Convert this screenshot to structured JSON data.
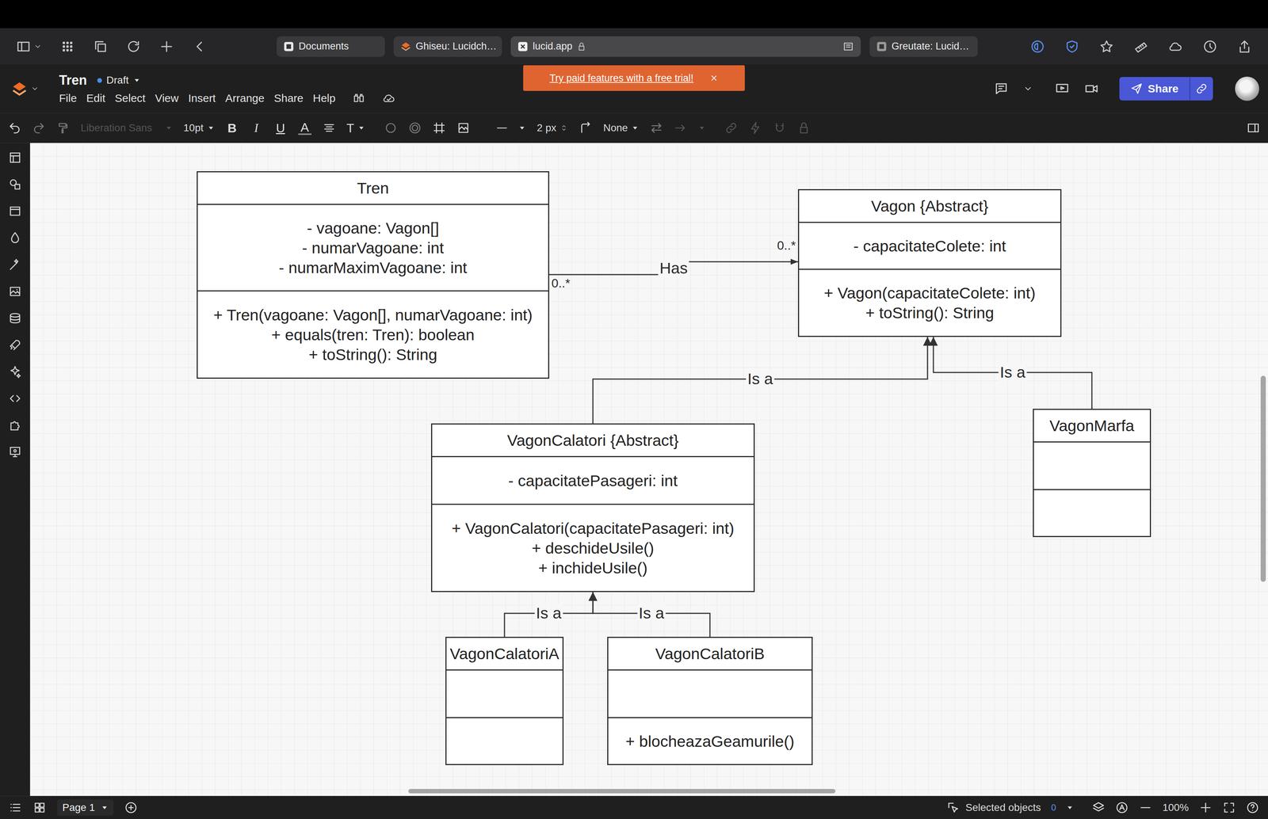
{
  "browser": {
    "tabs": [
      {
        "label": "Documents",
        "selected": false
      },
      {
        "label": "Ghiseu: Lucidch…",
        "selected": false
      },
      {
        "label": "lucid.app",
        "selected": true
      },
      {
        "label": "Greutate: Lucid…",
        "selected": false
      }
    ]
  },
  "document": {
    "title": "Tren",
    "status": "Draft"
  },
  "menu": [
    "File",
    "Edit",
    "Select",
    "View",
    "Insert",
    "Arrange",
    "Share",
    "Help"
  ],
  "banner": {
    "text": "Try paid features with a free trial!"
  },
  "share_button": "Share",
  "toolbar": {
    "font": {
      "value": "Liberation Sans",
      "disabled": true
    },
    "size": "10pt",
    "format": [
      {
        "label": "B",
        "kind": "bold"
      },
      {
        "label": "I",
        "kind": "italic"
      },
      {
        "label": "U",
        "kind": "underline"
      },
      {
        "label": "A",
        "kind": "color"
      }
    ],
    "text_tool": "T",
    "line_width": "2 px",
    "end_style": "None"
  },
  "diagram": {
    "classes": [
      {
        "name": "Tren",
        "attributes": [
          "- vagoane: Vagon[]",
          "- numarVagoane: int",
          "- numarMaximVagoane: int"
        ],
        "methods": [
          "+ Tren(vagoane: Vagon[], numarVagoane: int)",
          "+ equals(tren: Tren): boolean",
          "+ toString(): String"
        ]
      },
      {
        "name": "Vagon {Abstract}",
        "attributes": [
          "- capacitateColete: int"
        ],
        "methods": [
          "+ Vagon(capacitateColete: int)",
          "+ toString(): String"
        ]
      },
      {
        "name": "VagonCalatori {Abstract}",
        "attributes": [
          "- capacitatePasageri: int"
        ],
        "methods": [
          "+ VagonCalatori(capacitatePasageri: int)",
          "+ deschideUsile()",
          "+ inchideUsile()"
        ]
      },
      {
        "name": "VagonMarfa",
        "attributes": [],
        "methods": []
      },
      {
        "name": "VagonCalatoriA",
        "attributes": [],
        "methods": []
      },
      {
        "name": "VagonCalatoriB",
        "attributes": [],
        "methods": [
          "+ blocheazaGeamurile()"
        ]
      }
    ],
    "relations": [
      {
        "kind": "association",
        "from": "Tren",
        "to": "Vagon {Abstract}",
        "label": "Has",
        "from_multiplicity": "0..*",
        "to_multiplicity": "0..*"
      },
      {
        "kind": "generalization",
        "from": "VagonCalatori {Abstract}",
        "to": "Vagon {Abstract}",
        "label": "Is a"
      },
      {
        "kind": "generalization",
        "from": "VagonMarfa",
        "to": "Vagon {Abstract}",
        "label": "Is a"
      },
      {
        "kind": "generalization",
        "from": "VagonCalatoriA",
        "to": "VagonCalatori {Abstract}",
        "label": "Is a"
      },
      {
        "kind": "generalization",
        "from": "VagonCalatoriB",
        "to": "VagonCalatori {Abstract}",
        "label": "Is a"
      }
    ]
  },
  "status_bar": {
    "page": "Page 1",
    "selection_label": "Selected objects",
    "selection_count": "0",
    "zoom": "100%"
  }
}
